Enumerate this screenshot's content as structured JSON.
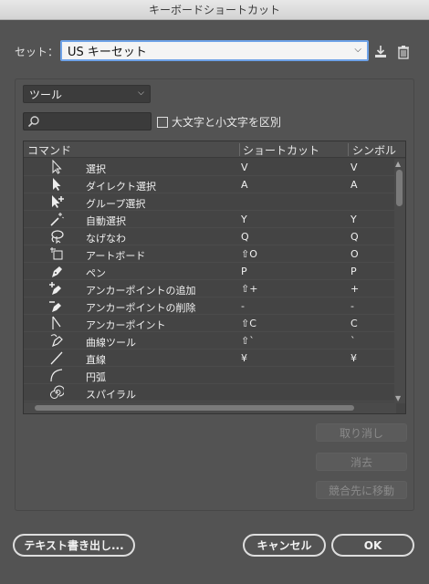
{
  "window": {
    "title": "キーボードショートカット"
  },
  "set": {
    "label": "セット：",
    "value": "US キーセット"
  },
  "category": {
    "value": "ツール"
  },
  "search": {
    "placeholder": ""
  },
  "case_option": {
    "label": "大文字と小文字を区別"
  },
  "table": {
    "headers": {
      "command": "コマンド",
      "shortcut": "ショートカット",
      "symbol": "シンボル"
    },
    "rows": [
      {
        "icon": "selection-arrow-icon",
        "name": "選択",
        "shortcut": "V",
        "symbol": "V"
      },
      {
        "icon": "direct-selection-icon",
        "name": "ダイレクト選択",
        "shortcut": "A",
        "symbol": "A"
      },
      {
        "icon": "group-selection-icon",
        "name": "グループ選択",
        "shortcut": "",
        "symbol": ""
      },
      {
        "icon": "magic-wand-icon",
        "name": "自動選択",
        "shortcut": "Y",
        "symbol": "Y"
      },
      {
        "icon": "lasso-icon",
        "name": "なげなわ",
        "shortcut": "Q",
        "symbol": "Q"
      },
      {
        "icon": "artboard-icon",
        "name": "アートボード",
        "shortcut": "⇧O",
        "symbol": "O"
      },
      {
        "icon": "pen-icon",
        "name": "ペン",
        "shortcut": "P",
        "symbol": "P"
      },
      {
        "icon": "add-anchor-icon",
        "name": "アンカーポイントの追加",
        "shortcut": "⇧+",
        "symbol": "+"
      },
      {
        "icon": "delete-anchor-icon",
        "name": "アンカーポイントの削除",
        "shortcut": "-",
        "symbol": "-"
      },
      {
        "icon": "anchor-point-icon",
        "name": "アンカーポイント",
        "shortcut": "⇧C",
        "symbol": "C"
      },
      {
        "icon": "curvature-icon",
        "name": "曲線ツール",
        "shortcut": "⇧`",
        "symbol": "`"
      },
      {
        "icon": "line-icon",
        "name": "直線",
        "shortcut": "¥",
        "symbol": "¥"
      },
      {
        "icon": "arc-icon",
        "name": "円弧",
        "shortcut": "",
        "symbol": ""
      },
      {
        "icon": "spiral-icon",
        "name": "スパイラル",
        "shortcut": "",
        "symbol": ""
      }
    ]
  },
  "buttons": {
    "undo": "取り消し",
    "clear": "消去",
    "go_to_conflict": "競合先に移動",
    "export_text": "テキスト書き出し...",
    "cancel": "キャンセル",
    "ok": "OK"
  }
}
